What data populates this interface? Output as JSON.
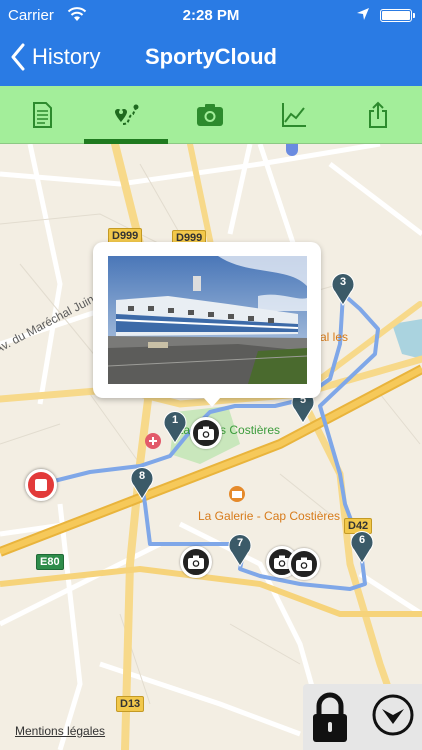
{
  "status": {
    "carrier": "Carrier",
    "time": "2:28 PM"
  },
  "nav": {
    "back_label": "History",
    "title": "SportyCloud"
  },
  "tabs": [
    {
      "icon": "document-icon",
      "active": false
    },
    {
      "icon": "route-icon",
      "active": true
    },
    {
      "icon": "camera-icon",
      "active": false
    },
    {
      "icon": "chart-icon",
      "active": false
    },
    {
      "icon": "share-icon",
      "active": false
    }
  ],
  "colors": {
    "nav_blue": "#2a7be4",
    "tab_green": "#a3ee9a",
    "active_tab": "#1f7a1f",
    "route": "#7fa7e8",
    "pin": "#3b5a68",
    "stop": "#e23a3a"
  },
  "map": {
    "road_signs": [
      "D999",
      "D999",
      "D42",
      "E80",
      "D13"
    ],
    "labels": {
      "street": "Av. du Maréchal Juin",
      "poi_partial": "al les",
      "stadium": "Stade des Costières",
      "mall": "La Galerie - Cap Costières"
    },
    "waypoints": [
      "1",
      "3",
      "5",
      "6",
      "7",
      "8"
    ],
    "legal_link": "Mentions légales"
  }
}
